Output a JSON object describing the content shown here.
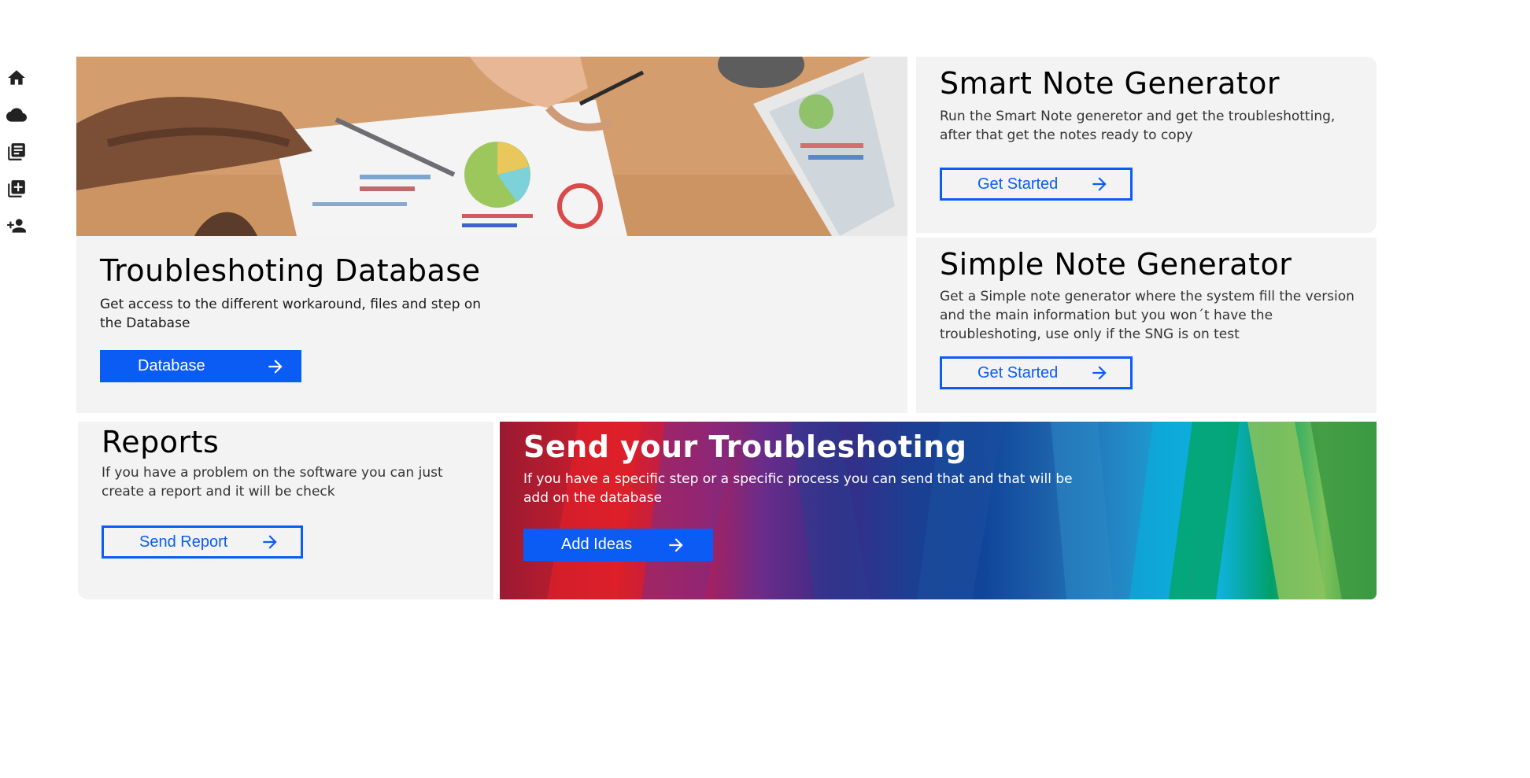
{
  "sidebar": {
    "items": [
      {
        "icon": "home-icon"
      },
      {
        "icon": "cloud-icon"
      },
      {
        "icon": "library-books-icon"
      },
      {
        "icon": "library-add-icon"
      },
      {
        "icon": "person-add-icon"
      }
    ]
  },
  "database_card": {
    "title": "Troubleshoting Database",
    "description": "Get access to the different workaround, files and step on the Database",
    "button_label": "Database",
    "image_icon": "hero-image"
  },
  "smart_note": {
    "title": "Smart Note Generator",
    "description": "Run the Smart Note generetor and get the troubleshotting, after that get the notes ready to copy",
    "button_label": "Get Started"
  },
  "simple_note": {
    "title": "Simple Note Generator",
    "description": "Get a Simple note generator where the system fill the version and the main information but you won´t have the troubleshoting, use only if the SNG is on test",
    "button_label": "Get Started"
  },
  "reports": {
    "title": "Reports",
    "description": "If you have a problem on the software you can just create a report and it will be check",
    "button_label": "Send Report"
  },
  "send_troubleshooting": {
    "title": "Send your Troubleshoting",
    "description": "If you have a specific step or a specific process you can send that and that will be add on the database",
    "button_label": "Add Ideas"
  },
  "colors": {
    "accent": "#0b5cf5",
    "card_bg": "#f3f3f3"
  }
}
